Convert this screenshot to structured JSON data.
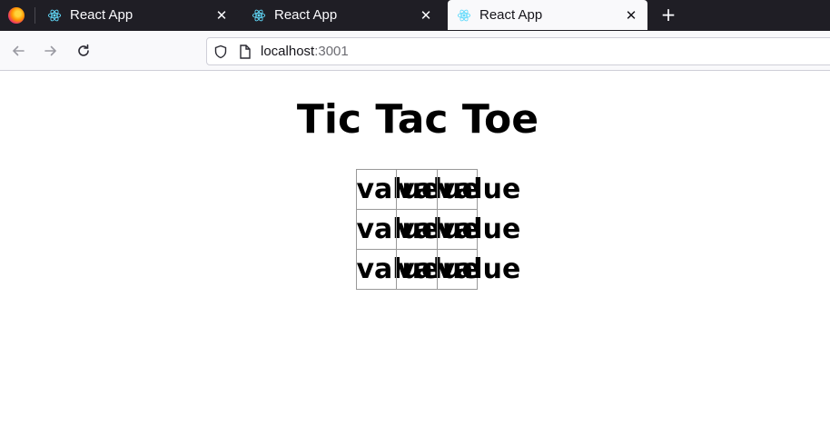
{
  "browser": {
    "tabs": [
      {
        "title": "React App",
        "active": false
      },
      {
        "title": "React App",
        "active": false
      },
      {
        "title": "React App",
        "active": true
      }
    ],
    "url": {
      "host": "localhost",
      "port": ":3001"
    }
  },
  "page": {
    "title": "Tic Tac Toe",
    "board": [
      [
        "value",
        "value",
        "value"
      ],
      [
        "value",
        "value",
        "value"
      ],
      [
        "value",
        "value",
        "value"
      ]
    ]
  },
  "colors": {
    "react": "#61dafb",
    "tabbar": "#1f1e25",
    "toolbar": "#f9f9fb"
  }
}
